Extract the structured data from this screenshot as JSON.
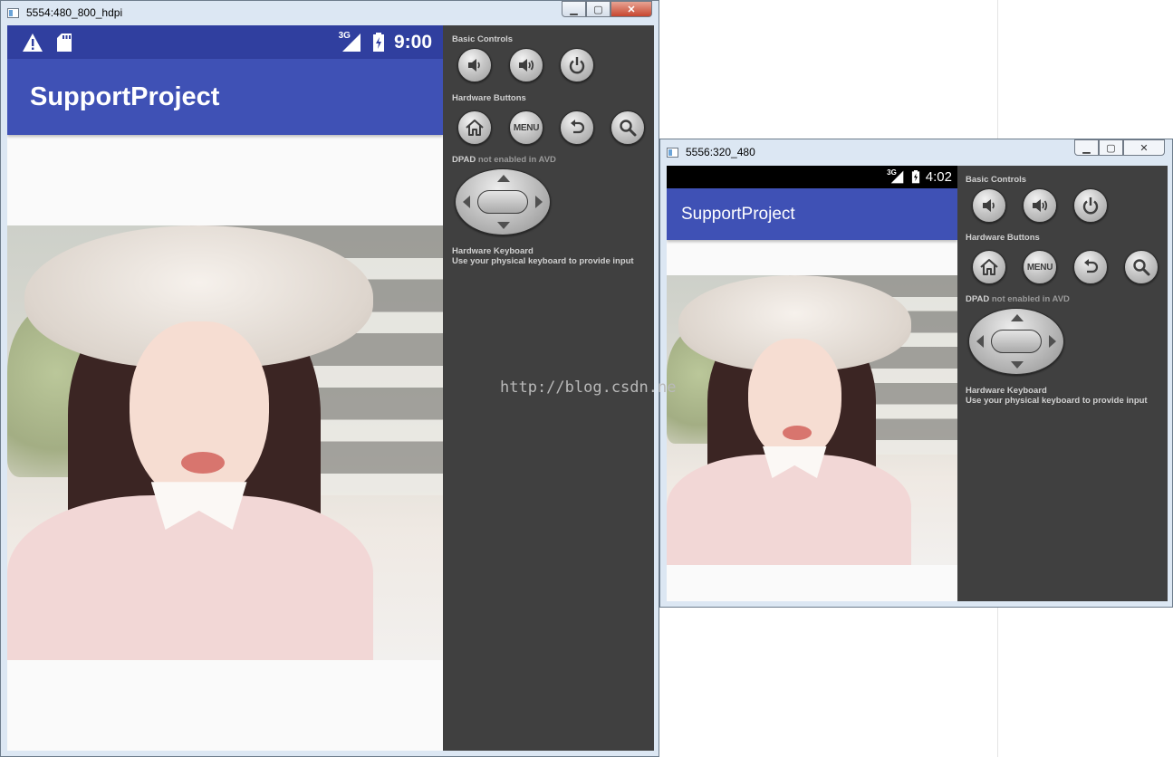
{
  "windows": [
    {
      "title": "5554:480_800_hdpi",
      "status_time": "9:00",
      "network": "3G",
      "app_title": "SupportProject"
    },
    {
      "title": "5556:320_480",
      "status_time": "4:02",
      "network": "3G",
      "app_title": "SupportProject"
    }
  ],
  "controls": {
    "basic_controls_label": "Basic Controls",
    "hardware_buttons_label": "Hardware Buttons",
    "dpad_label": "DPAD",
    "dpad_note": "not enabled in AVD",
    "keyboard_label": "Hardware Keyboard",
    "keyboard_note": "Use your physical keyboard to provide input",
    "menu_label": "MENU"
  },
  "icons": [
    "window-app-icon",
    "warning-icon",
    "sd-card-icon",
    "signal-icon",
    "battery-icon",
    "volume-down-icon",
    "volume-up-icon",
    "power-icon",
    "home-icon",
    "back-icon",
    "search-icon",
    "dpad-icon"
  ],
  "watermark": "http://blog.csdn.ne",
  "colors": {
    "app_bar": "#3f51b5",
    "status_bar_1": "#303f9f",
    "status_bar_2": "#000000",
    "panel": "#404040"
  }
}
